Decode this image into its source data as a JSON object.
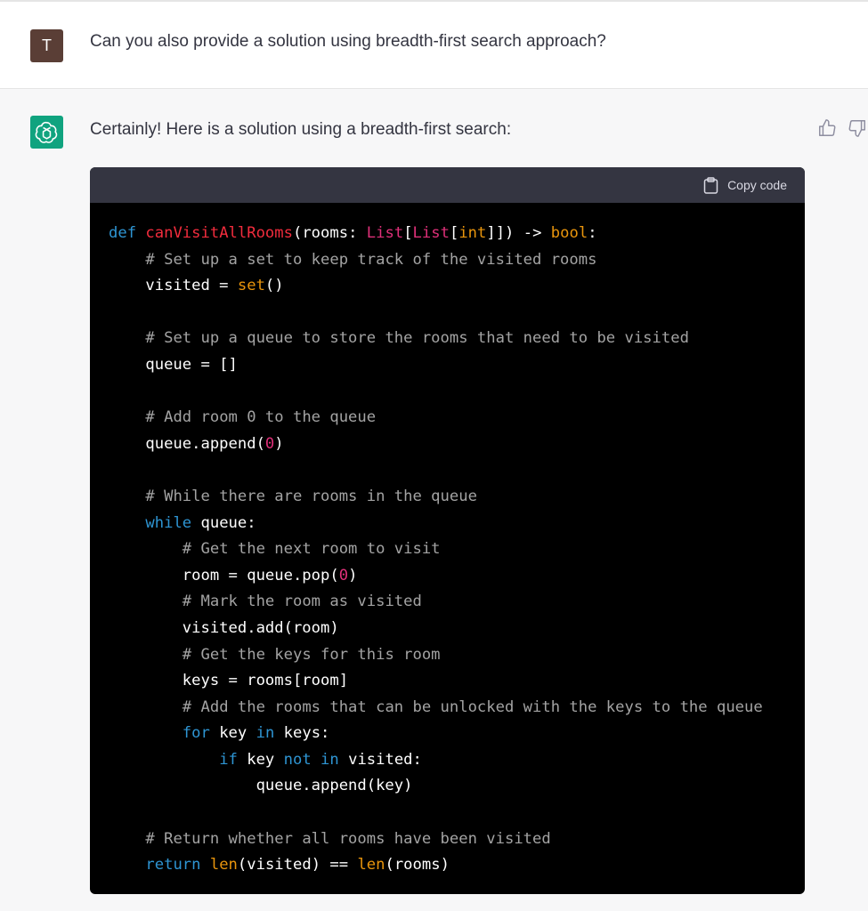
{
  "user_message": {
    "avatar_letter": "T",
    "text": "Can you also provide a solution using breadth-first search approach?"
  },
  "assistant_message": {
    "intro": "Certainly! Here is a solution using a breadth-first search:",
    "copy_label": "Copy code",
    "icons": [
      "openai-logo-icon",
      "thumbs-up-icon",
      "thumbs-down-icon",
      "clipboard-icon"
    ],
    "code_lines": [
      [
        {
          "t": "def ",
          "c": "kw"
        },
        {
          "t": "canVisitAllRooms",
          "c": "fn"
        },
        {
          "t": "(rooms: "
        },
        {
          "t": "List",
          "c": "ty"
        },
        {
          "t": "["
        },
        {
          "t": "List",
          "c": "ty"
        },
        {
          "t": "["
        },
        {
          "t": "int",
          "c": "bt"
        },
        {
          "t": "]]) -> "
        },
        {
          "t": "bool",
          "c": "bt"
        },
        {
          "t": ":"
        }
      ],
      [
        {
          "t": "    "
        },
        {
          "t": "# Set up a set to keep track of the visited rooms",
          "c": "cm"
        }
      ],
      [
        {
          "t": "    visited = "
        },
        {
          "t": "set",
          "c": "bt"
        },
        {
          "t": "()"
        }
      ],
      [
        {
          "t": ""
        }
      ],
      [
        {
          "t": "    "
        },
        {
          "t": "# Set up a queue to store the rooms that need to be visited",
          "c": "cm"
        }
      ],
      [
        {
          "t": "    queue = []"
        }
      ],
      [
        {
          "t": ""
        }
      ],
      [
        {
          "t": "    "
        },
        {
          "t": "# Add room 0 to the queue",
          "c": "cm"
        }
      ],
      [
        {
          "t": "    queue.append("
        },
        {
          "t": "0",
          "c": "num"
        },
        {
          "t": ")"
        }
      ],
      [
        {
          "t": ""
        }
      ],
      [
        {
          "t": "    "
        },
        {
          "t": "# While there are rooms in the queue",
          "c": "cm"
        }
      ],
      [
        {
          "t": "    "
        },
        {
          "t": "while",
          "c": "kw"
        },
        {
          "t": " queue:"
        }
      ],
      [
        {
          "t": "        "
        },
        {
          "t": "# Get the next room to visit",
          "c": "cm"
        }
      ],
      [
        {
          "t": "        room = queue.pop("
        },
        {
          "t": "0",
          "c": "num"
        },
        {
          "t": ")"
        }
      ],
      [
        {
          "t": "        "
        },
        {
          "t": "# Mark the room as visited",
          "c": "cm"
        }
      ],
      [
        {
          "t": "        visited.add(room)"
        }
      ],
      [
        {
          "t": "        "
        },
        {
          "t": "# Get the keys for this room",
          "c": "cm"
        }
      ],
      [
        {
          "t": "        keys = rooms[room]"
        }
      ],
      [
        {
          "t": "        "
        },
        {
          "t": "# Add the rooms that can be unlocked with the keys to the queue",
          "c": "cm"
        }
      ],
      [
        {
          "t": "        "
        },
        {
          "t": "for",
          "c": "kw"
        },
        {
          "t": " key "
        },
        {
          "t": "in",
          "c": "kw"
        },
        {
          "t": " keys:"
        }
      ],
      [
        {
          "t": "            "
        },
        {
          "t": "if",
          "c": "kw"
        },
        {
          "t": " key "
        },
        {
          "t": "not",
          "c": "kw"
        },
        {
          "t": " "
        },
        {
          "t": "in",
          "c": "kw"
        },
        {
          "t": " visited:"
        }
      ],
      [
        {
          "t": "                queue.append(key)"
        }
      ],
      [
        {
          "t": ""
        }
      ],
      [
        {
          "t": "    "
        },
        {
          "t": "# Return whether all rooms have been visited",
          "c": "cm"
        }
      ],
      [
        {
          "t": "    "
        },
        {
          "t": "return",
          "c": "kw"
        },
        {
          "t": " "
        },
        {
          "t": "len",
          "c": "bt"
        },
        {
          "t": "(visited) == "
        },
        {
          "t": "len",
          "c": "bt"
        },
        {
          "t": "(rooms)"
        }
      ]
    ]
  },
  "colors": {
    "assistant_avatar": "#10a37f",
    "user_avatar": "#5a3e36",
    "code_bg": "#000000",
    "code_header": "#343541"
  }
}
